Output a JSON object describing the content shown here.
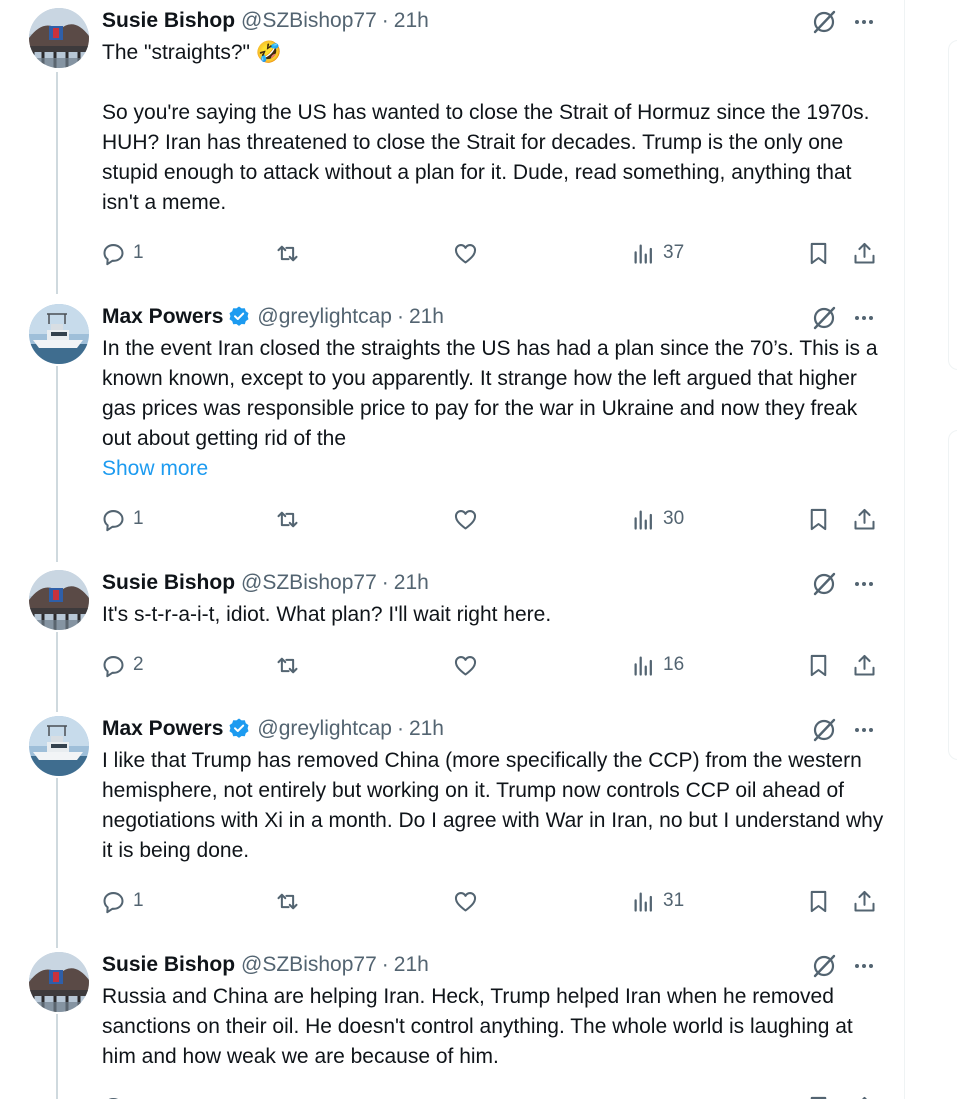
{
  "tweets": [
    {
      "author": "Susie Bishop",
      "handle": "@SZBishop77",
      "time": "21h",
      "verified": false,
      "avatar": "bridge-photo",
      "text": "The \"straights?\" 🤣\n\nSo you're saying the US has wanted to close the Strait of Hormuz since the 1970s. HUH? Iran has threatened to close the Strait for decades. Trump is the only one stupid enough to attack without a plan for it. Dude, read something, anything that isn't a meme.",
      "show_more": "",
      "replies": "1",
      "views": "37"
    },
    {
      "author": "Max Powers",
      "handle": "@greylightcap",
      "time": "21h",
      "verified": true,
      "avatar": "boat-photo",
      "text": "In the event Iran closed the straights the US has had a plan since the 70’s. This is a known known, except to you apparently. It strange how the left argued that higher gas prices was responsible price to pay for the war in Ukraine and now they freak out about getting rid of the",
      "show_more": "Show more",
      "replies": "1",
      "views": "30"
    },
    {
      "author": "Susie Bishop",
      "handle": "@SZBishop77",
      "time": "21h",
      "verified": false,
      "avatar": "bridge-photo",
      "text": "It's s-t-r-a-i-t, idiot. What plan? I'll wait right here.",
      "show_more": "",
      "replies": "2",
      "views": "16"
    },
    {
      "author": "Max Powers",
      "handle": "@greylightcap",
      "time": "21h",
      "verified": true,
      "avatar": "boat-photo",
      "text": "I like that Trump has removed China (more specifically the CCP) from the western hemisphere, not entirely but working on it. Trump now controls CCP oil ahead of negotiations with Xi in a month. Do I agree with War in Iran, no but I understand why it is being done.",
      "show_more": "",
      "replies": "1",
      "views": "31"
    },
    {
      "author": "Susie Bishop",
      "handle": "@SZBishop77",
      "time": "21h",
      "verified": false,
      "avatar": "bridge-photo",
      "text": "Russia and China are helping Iran. Heck, Trump helped Iran when he removed sanctions on their oil. He doesn't control anything. The whole world is laughing at him and how weak we are because of him.",
      "show_more": "",
      "replies": "",
      "views": ""
    }
  ],
  "dot": "·",
  "colors": {
    "text": "#0f1419",
    "secondary": "#536471",
    "link": "#1d9bf0",
    "verified": "#1d9bf0",
    "thread_line": "#cfd9de"
  }
}
